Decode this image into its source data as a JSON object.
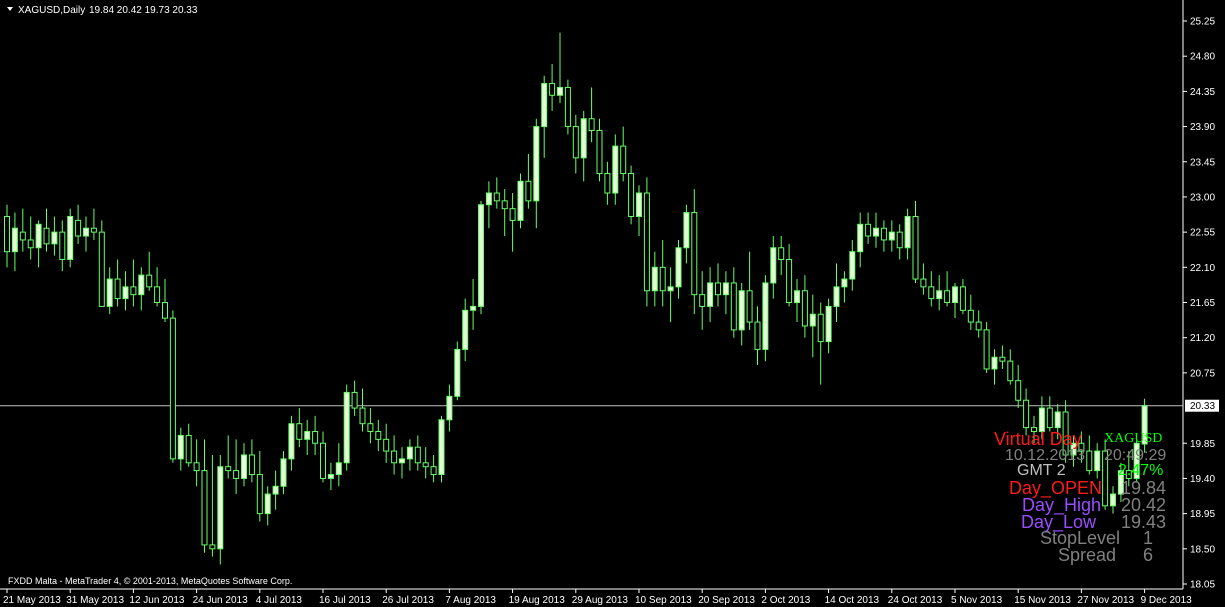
{
  "header": {
    "symbol": "XAGUSD,Daily",
    "ohlc": "19.84 20.42 19.73 20.33"
  },
  "footer": {
    "copyright": "FXDD Malta - MetaTrader 4, © 2001-2013, MetaQuotes Software Corp."
  },
  "current_price_label": "20.33",
  "colors": {
    "background": "#000000",
    "candle": "#66ff66",
    "bull_body": "#e6ffd9",
    "bear_body": "#000000",
    "text": "#ffffff",
    "price_line": "#c0c0c0",
    "red": "#ff1a1a",
    "green": "#00ff00",
    "purple": "#9a4dff",
    "grey": "#c0c0c0"
  },
  "info_panel": {
    "title": "Virtual Day",
    "symbol": "XAGUSD",
    "datetime": "10.12.2013",
    "time": "20:49:29",
    "gmt_label": "GMT 2",
    "change": "2.47%",
    "day_open_label": "Day_OPEN",
    "day_open_value": "19.84",
    "day_high_label": "Day_High",
    "day_high_value": "20.42",
    "day_low_label": "Day_Low",
    "day_low_value": "19.43",
    "stoplevel_label": "StopLevel",
    "stoplevel_value": "1",
    "spread_label": "Spread",
    "spread_value": "6"
  },
  "chart_data": {
    "type": "candlestick",
    "title": "XAGUSD,Daily",
    "ylim": [
      18.05,
      25.25
    ],
    "y_ticks": [
      "25.25",
      "24.80",
      "24.35",
      "23.90",
      "23.45",
      "23.00",
      "22.55",
      "22.10",
      "21.65",
      "21.20",
      "20.75",
      "20.33",
      "19.85",
      "19.40",
      "18.95",
      "18.50",
      "18.05"
    ],
    "x_ticks": [
      {
        "label": "21 May 2013",
        "index": 0
      },
      {
        "label": "31 May 2013",
        "index": 8
      },
      {
        "label": "12 Jun 2013",
        "index": 16
      },
      {
        "label": "24 Jun 2013",
        "index": 24
      },
      {
        "label": "4 Jul 2013",
        "index": 32
      },
      {
        "label": "16 Jul 2013",
        "index": 40
      },
      {
        "label": "26 Jul 2013",
        "index": 48
      },
      {
        "label": "7 Aug 2013",
        "index": 56
      },
      {
        "label": "19 Aug 2013",
        "index": 64
      },
      {
        "label": "29 Aug 2013",
        "index": 72
      },
      {
        "label": "10 Sep 2013",
        "index": 80
      },
      {
        "label": "20 Sep 2013",
        "index": 88
      },
      {
        "label": "2 Oct 2013",
        "index": 96
      },
      {
        "label": "14 Oct 2013",
        "index": 104
      },
      {
        "label": "24 Oct 2013",
        "index": 112
      },
      {
        "label": "5 Nov 2013",
        "index": 120
      },
      {
        "label": "15 Nov 2013",
        "index": 128
      },
      {
        "label": "27 Nov 2013",
        "index": 136
      },
      {
        "label": "9 Dec 2013",
        "index": 144
      }
    ],
    "last_price": 20.33,
    "series": [
      {
        "name": "XAGUSD",
        "ohlc": [
          [
            22.75,
            22.9,
            22.1,
            22.3
          ],
          [
            22.3,
            22.8,
            22.05,
            22.6
          ],
          [
            22.55,
            22.85,
            22.3,
            22.45
          ],
          [
            22.45,
            22.75,
            22.2,
            22.35
          ],
          [
            22.35,
            22.7,
            22.1,
            22.65
          ],
          [
            22.6,
            22.85,
            22.3,
            22.4
          ],
          [
            22.4,
            22.75,
            22.25,
            22.55
          ],
          [
            22.55,
            22.7,
            22.05,
            22.2
          ],
          [
            22.2,
            22.85,
            22.1,
            22.75
          ],
          [
            22.7,
            22.9,
            22.4,
            22.5
          ],
          [
            22.5,
            22.75,
            22.3,
            22.6
          ],
          [
            22.6,
            22.85,
            22.45,
            22.55
          ],
          [
            22.55,
            22.7,
            21.8,
            21.6
          ],
          [
            21.6,
            22.1,
            21.5,
            21.95
          ],
          [
            21.95,
            22.2,
            21.6,
            21.7
          ],
          [
            21.7,
            22.05,
            21.55,
            21.85
          ],
          [
            21.85,
            22.2,
            21.6,
            21.75
          ],
          [
            21.75,
            22.1,
            21.55,
            22.0
          ],
          [
            22.0,
            22.3,
            21.8,
            21.85
          ],
          [
            21.85,
            22.1,
            21.6,
            21.65
          ],
          [
            21.65,
            21.95,
            21.4,
            21.45
          ],
          [
            21.45,
            21.55,
            19.6,
            19.65
          ],
          [
            19.65,
            20.05,
            19.5,
            19.95
          ],
          [
            19.95,
            20.1,
            19.55,
            19.6
          ],
          [
            19.6,
            19.9,
            19.3,
            19.5
          ],
          [
            19.5,
            19.9,
            18.45,
            18.55
          ],
          [
            18.55,
            19.7,
            18.4,
            18.5
          ],
          [
            18.5,
            19.7,
            18.3,
            19.55
          ],
          [
            19.55,
            19.95,
            19.4,
            19.5
          ],
          [
            19.5,
            19.9,
            19.2,
            19.4
          ],
          [
            19.4,
            19.85,
            19.3,
            19.7
          ],
          [
            19.7,
            19.9,
            19.35,
            19.45
          ],
          [
            19.45,
            19.75,
            18.85,
            18.95
          ],
          [
            18.95,
            19.3,
            18.8,
            19.2
          ],
          [
            19.2,
            19.5,
            19.0,
            19.3
          ],
          [
            19.3,
            19.75,
            19.2,
            19.65
          ],
          [
            19.65,
            20.2,
            19.5,
            20.1
          ],
          [
            20.1,
            20.3,
            19.8,
            19.9
          ],
          [
            19.9,
            20.15,
            19.7,
            20.0
          ],
          [
            20.0,
            20.2,
            19.7,
            19.85
          ],
          [
            19.85,
            20.0,
            19.35,
            19.4
          ],
          [
            19.4,
            19.6,
            19.25,
            19.45
          ],
          [
            19.45,
            19.85,
            19.3,
            19.6
          ],
          [
            19.6,
            20.6,
            19.5,
            20.5
          ],
          [
            20.5,
            20.65,
            20.2,
            20.3
          ],
          [
            20.3,
            20.55,
            20.0,
            20.1
          ],
          [
            20.1,
            20.3,
            19.85,
            20.0
          ],
          [
            20.0,
            20.15,
            19.75,
            19.9
          ],
          [
            19.9,
            20.1,
            19.6,
            19.75
          ],
          [
            19.75,
            19.95,
            19.45,
            19.6
          ],
          [
            19.6,
            19.8,
            19.4,
            19.65
          ],
          [
            19.65,
            19.9,
            19.5,
            19.8
          ],
          [
            19.8,
            19.95,
            19.5,
            19.6
          ],
          [
            19.6,
            19.8,
            19.4,
            19.55
          ],
          [
            19.55,
            19.7,
            19.35,
            19.45
          ],
          [
            19.45,
            20.2,
            19.35,
            20.15
          ],
          [
            20.15,
            20.6,
            20.0,
            20.45
          ],
          [
            20.45,
            21.15,
            20.4,
            21.05
          ],
          [
            21.05,
            21.7,
            20.9,
            21.55
          ],
          [
            21.55,
            21.95,
            21.3,
            21.6
          ],
          [
            21.6,
            22.95,
            21.5,
            22.9
          ],
          [
            22.9,
            23.2,
            22.6,
            23.05
          ],
          [
            23.05,
            23.25,
            22.85,
            22.95
          ],
          [
            22.95,
            23.1,
            22.5,
            22.85
          ],
          [
            22.85,
            23.05,
            22.3,
            22.7
          ],
          [
            22.7,
            23.3,
            22.6,
            23.2
          ],
          [
            23.2,
            23.55,
            22.85,
            22.95
          ],
          [
            22.95,
            24.0,
            22.6,
            23.9
          ],
          [
            23.9,
            24.55,
            23.5,
            24.45
          ],
          [
            24.45,
            24.7,
            24.1,
            24.3
          ],
          [
            24.3,
            25.1,
            24.2,
            24.4
          ],
          [
            24.4,
            24.5,
            23.8,
            23.9
          ],
          [
            23.9,
            24.05,
            23.3,
            23.5
          ],
          [
            23.5,
            24.1,
            23.2,
            24.0
          ],
          [
            24.0,
            24.4,
            23.7,
            23.85
          ],
          [
            23.85,
            24.0,
            23.2,
            23.3
          ],
          [
            23.3,
            23.45,
            22.9,
            23.05
          ],
          [
            23.05,
            23.8,
            22.9,
            23.65
          ],
          [
            23.65,
            23.9,
            23.2,
            23.3
          ],
          [
            23.3,
            23.4,
            22.65,
            22.75
          ],
          [
            22.75,
            23.15,
            22.5,
            23.05
          ],
          [
            23.05,
            23.25,
            21.6,
            21.8
          ],
          [
            21.8,
            22.3,
            21.6,
            22.1
          ],
          [
            22.1,
            22.45,
            21.6,
            21.8
          ],
          [
            21.8,
            22.1,
            21.4,
            21.85
          ],
          [
            21.85,
            22.45,
            21.7,
            22.35
          ],
          [
            22.35,
            22.9,
            22.15,
            22.8
          ],
          [
            22.8,
            23.1,
            21.5,
            21.75
          ],
          [
            21.75,
            22.05,
            21.3,
            21.6
          ],
          [
            21.6,
            22.1,
            21.4,
            21.9
          ],
          [
            21.9,
            22.15,
            21.6,
            21.75
          ],
          [
            21.75,
            22.05,
            21.5,
            21.9
          ],
          [
            21.9,
            22.1,
            21.2,
            21.3
          ],
          [
            21.3,
            21.9,
            21.1,
            21.8
          ],
          [
            21.8,
            22.3,
            21.3,
            21.4
          ],
          [
            21.4,
            21.6,
            20.85,
            21.05
          ],
          [
            21.05,
            22.0,
            20.9,
            21.9
          ],
          [
            21.9,
            22.5,
            21.7,
            22.35
          ],
          [
            22.35,
            22.5,
            22.0,
            22.2
          ],
          [
            22.2,
            22.4,
            21.6,
            21.65
          ],
          [
            21.65,
            21.95,
            21.4,
            21.8
          ],
          [
            21.8,
            22.0,
            21.2,
            21.35
          ],
          [
            21.35,
            21.75,
            20.95,
            21.5
          ],
          [
            21.5,
            21.65,
            20.6,
            21.15
          ],
          [
            21.15,
            21.7,
            21.0,
            21.6
          ],
          [
            21.6,
            22.15,
            21.4,
            21.85
          ],
          [
            21.85,
            22.05,
            21.65,
            21.95
          ],
          [
            21.95,
            22.45,
            21.8,
            22.3
          ],
          [
            22.3,
            22.8,
            22.1,
            22.65
          ],
          [
            22.65,
            22.8,
            22.4,
            22.5
          ],
          [
            22.5,
            22.8,
            22.35,
            22.6
          ],
          [
            22.6,
            22.7,
            22.3,
            22.45
          ],
          [
            22.45,
            22.7,
            22.3,
            22.55
          ],
          [
            22.55,
            22.65,
            22.2,
            22.35
          ],
          [
            22.35,
            22.85,
            22.2,
            22.75
          ],
          [
            22.75,
            22.95,
            21.9,
            21.95
          ],
          [
            21.95,
            22.15,
            21.75,
            21.85
          ],
          [
            21.85,
            22.05,
            21.6,
            21.7
          ],
          [
            21.7,
            22.0,
            21.55,
            21.8
          ],
          [
            21.8,
            22.05,
            21.6,
            21.65
          ],
          [
            21.65,
            21.9,
            21.45,
            21.85
          ],
          [
            21.85,
            21.95,
            21.5,
            21.55
          ],
          [
            21.55,
            21.75,
            21.3,
            21.4
          ],
          [
            21.4,
            21.55,
            21.2,
            21.3
          ],
          [
            21.3,
            21.4,
            20.75,
            20.8
          ],
          [
            20.8,
            21.05,
            20.6,
            20.95
          ],
          [
            20.95,
            21.1,
            20.8,
            20.9
          ],
          [
            20.9,
            21.05,
            20.6,
            20.65
          ],
          [
            20.65,
            20.85,
            20.3,
            20.4
          ],
          [
            20.4,
            20.55,
            19.95,
            20.05
          ],
          [
            20.05,
            20.2,
            19.85,
            20.0
          ],
          [
            20.0,
            20.45,
            19.9,
            20.3
          ],
          [
            20.3,
            20.45,
            20.0,
            20.05
          ],
          [
            20.05,
            20.35,
            19.9,
            20.25
          ],
          [
            20.25,
            20.4,
            19.6,
            19.7
          ],
          [
            19.7,
            19.95,
            19.55,
            19.85
          ],
          [
            19.85,
            20.0,
            19.6,
            19.75
          ],
          [
            19.75,
            19.95,
            19.45,
            19.5
          ],
          [
            19.5,
            19.85,
            19.4,
            19.75
          ],
          [
            19.75,
            19.9,
            19.0,
            19.05
          ],
          [
            19.05,
            19.3,
            18.95,
            19.2
          ],
          [
            19.2,
            19.6,
            19.1,
            19.5
          ],
          [
            19.5,
            19.75,
            19.3,
            19.4
          ],
          [
            19.4,
            19.9,
            19.35,
            19.85
          ],
          [
            19.84,
            20.42,
            19.73,
            20.33
          ]
        ]
      }
    ]
  }
}
